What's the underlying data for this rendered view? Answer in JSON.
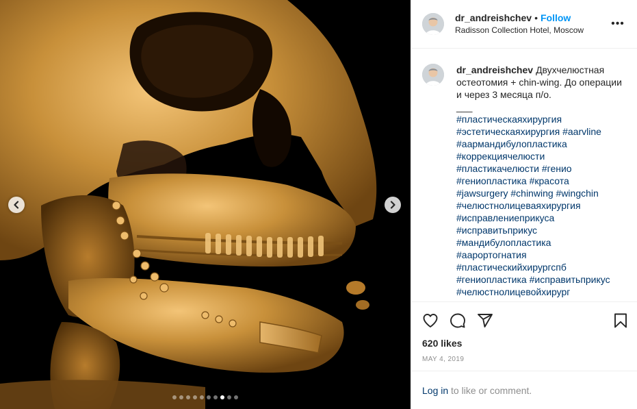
{
  "post": {
    "username": "dr_andreishchev",
    "separator": "•",
    "follow_label": "Follow",
    "location": "Radisson Collection Hotel, Moscow",
    "more_icon": "more-options-icon"
  },
  "media": {
    "subject": "3D CT scan of skull",
    "slide_count": 10,
    "active_slide": 8,
    "prev_icon": "chevron-left-icon",
    "next_icon": "chevron-right-icon"
  },
  "caption": {
    "username": "dr_andreishchev",
    "text": "Двухчелюстная остеотомия + chin-wing. До операции и через 3 месяца п/о.",
    "divider": "___",
    "hashtags": [
      "#пластическаяхирургия",
      "#эстетическаяхирургия",
      "#aarvline",
      "#аармандибулопластика",
      "#коррекциячелюсти",
      "#пластикачелюсти",
      "#гениo",
      "#гениопластика",
      "#красота",
      "#jawsurgery",
      "#chinwing",
      "#wingchin",
      "#челюстнолицеваяхирургия",
      "#исправлениеприкуса",
      "#исправитьприкус",
      "#мандибулопластика",
      "#аарортогнатия",
      "#пластическийхирургспб",
      "#гениопластика",
      "#исправитьприкус",
      "#челюстнолицевойхирург"
    ]
  },
  "actions": {
    "like_icon": "heart-icon",
    "comment_icon": "comment-icon",
    "share_icon": "share-icon",
    "save_icon": "bookmark-icon"
  },
  "stats": {
    "likes": "620 likes",
    "date": "MAY 4, 2019"
  },
  "login": {
    "link": "Log in",
    "text": " to like or comment."
  },
  "colors": {
    "accent": "#0095f6",
    "hashtag": "#00376b",
    "muted": "#8e8e8e",
    "bone": "#c8903a"
  }
}
